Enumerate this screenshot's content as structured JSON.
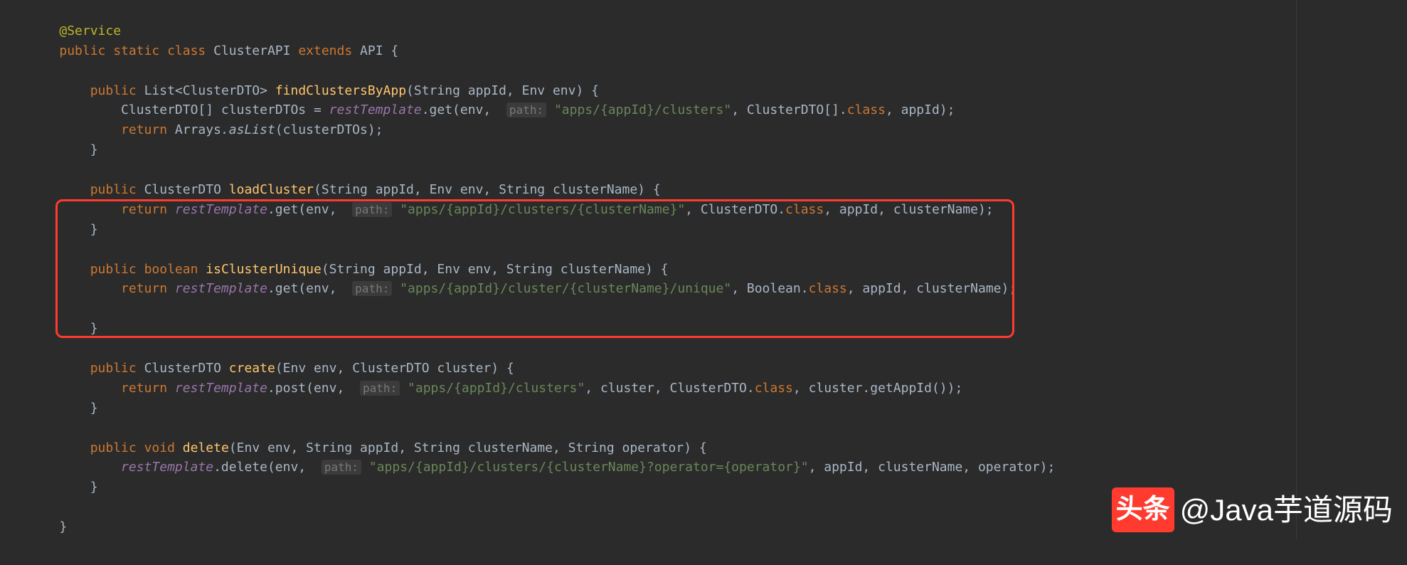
{
  "code": {
    "annotation": "@Service",
    "class_decl": {
      "modifiers": "public static class",
      "name": "ClusterAPI",
      "extends_kw": "extends",
      "parent": "API"
    },
    "methods": {
      "findClustersByApp": {
        "modifiers": "public",
        "return_type": "List<ClusterDTO>",
        "name": "findClustersByApp",
        "params": "(String appId, Env env) {",
        "body_line1_pre": "ClusterDTO[] clusterDTOs = ",
        "body_line1_field": "restTemplate",
        "body_line1_call": ".get(env, ",
        "body_line1_hint": "path:",
        "body_line1_str": "\"apps/{appId}/clusters\"",
        "body_line1_post": ", ClusterDTO[].",
        "body_line1_class": "class",
        "body_line1_end": ", appId);",
        "body_line2_ret": "return ",
        "body_line2_cls": "Arrays",
        "body_line2_method": ".asList",
        "body_line2_args": "(clusterDTOs);"
      },
      "loadCluster": {
        "modifiers": "public",
        "return_type": "ClusterDTO",
        "name": "loadCluster",
        "params": "(String appId, Env env, String clusterName) {",
        "body_ret": "return ",
        "body_field": "restTemplate",
        "body_call": ".get(env, ",
        "body_hint": "path:",
        "body_str": "\"apps/{appId}/clusters/{clusterName}\"",
        "body_post": ", ClusterDTO.",
        "body_class": "class",
        "body_end": ", appId, clusterName);"
      },
      "isClusterUnique": {
        "modifiers": "public",
        "return_type": "boolean",
        "name": "isClusterUnique",
        "params": "(String appId, Env env, String clusterName) {",
        "body_ret": "return ",
        "body_field": "restTemplate",
        "body_call": ".get(env, ",
        "body_hint": "path:",
        "body_str": "\"apps/{appId}/cluster/{clusterName}/unique\"",
        "body_post": ", Boolean.",
        "body_class": "class",
        "body_end": ", appId, clusterName);"
      },
      "create": {
        "modifiers": "public",
        "return_type": "ClusterDTO",
        "name": "create",
        "params": "(Env env, ClusterDTO cluster) {",
        "body_ret": "return ",
        "body_field": "restTemplate",
        "body_call": ".post(env, ",
        "body_hint": "path:",
        "body_str": "\"apps/{appId}/clusters\"",
        "body_post": ", cluster, ClusterDTO.",
        "body_class": "class",
        "body_end": ", cluster.getAppId());"
      },
      "delete": {
        "modifiers": "public",
        "return_type": "void",
        "name": "delete",
        "params": "(Env env, String appId, String clusterName, String operator) {",
        "body_field": "restTemplate",
        "body_call": ".delete(env, ",
        "body_hint": "path:",
        "body_str": "\"apps/{appId}/clusters/{clusterName}?operator={operator}\"",
        "body_end": ", appId, clusterName, operator);"
      }
    },
    "close_brace": "}"
  },
  "watermark": {
    "logo": "头条",
    "text": "@Java芋道源码"
  }
}
